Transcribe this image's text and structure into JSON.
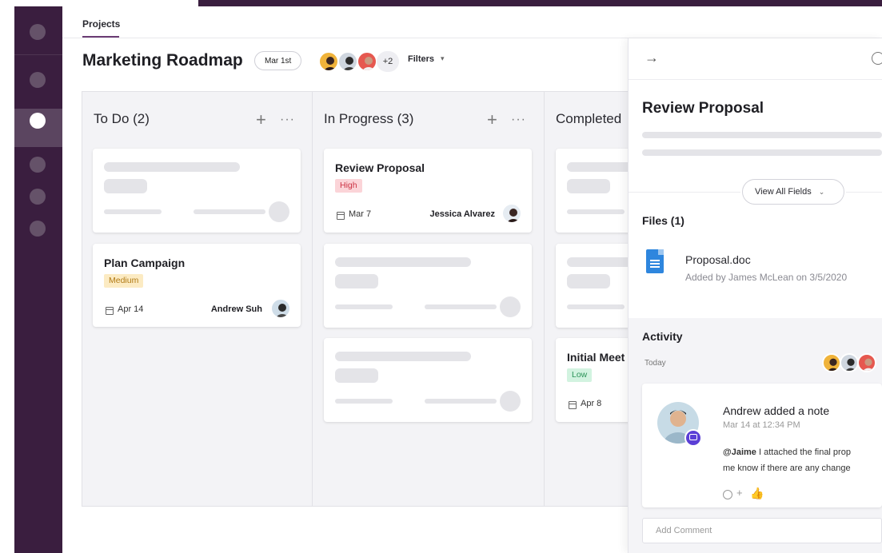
{
  "header": {
    "breadcrumb": "Projects",
    "title": "Marketing Roadmap",
    "date": "Mar 1st",
    "extra_members": "+2",
    "filters": "Filters",
    "filters_icon": "chevron-down-icon"
  },
  "colors": {
    "sidebar": "#3a1e3f",
    "high": "#cc3344",
    "medium": "#b17a14",
    "low": "#2b9358",
    "file_icon": "#2e86de"
  },
  "columns": [
    {
      "title": "To Do (2)"
    },
    {
      "title": "In Progress (3)"
    },
    {
      "title": "Completed"
    }
  ],
  "cards": {
    "plan_campaign": {
      "title": "Plan Campaign",
      "priority": "Medium",
      "due": "Apr 14",
      "assignee": "Andrew Suh"
    },
    "review_proposal": {
      "title": "Review Proposal",
      "priority": "High",
      "due": "Mar 7",
      "assignee": "Jessica Alvarez"
    },
    "initial_meeting": {
      "title": "Initial Meet",
      "priority": "Low",
      "due": "Apr 8"
    }
  },
  "panel": {
    "title": "Review Proposal",
    "view_all": "View All Fields",
    "files_heading": "Files (1)",
    "file_name": "Proposal.doc",
    "file_meta": "Added by James McLean on 3/5/2020",
    "activity_heading": "Activity",
    "today": "Today",
    "note_title": "Andrew added a note",
    "note_time": "Mar 14 at 12:34 PM",
    "note_mention": "@Jaime",
    "note_line1": " I attached the final prop",
    "note_line2": "me know if there are any change",
    "comment_placeholder": "Add Comment"
  }
}
